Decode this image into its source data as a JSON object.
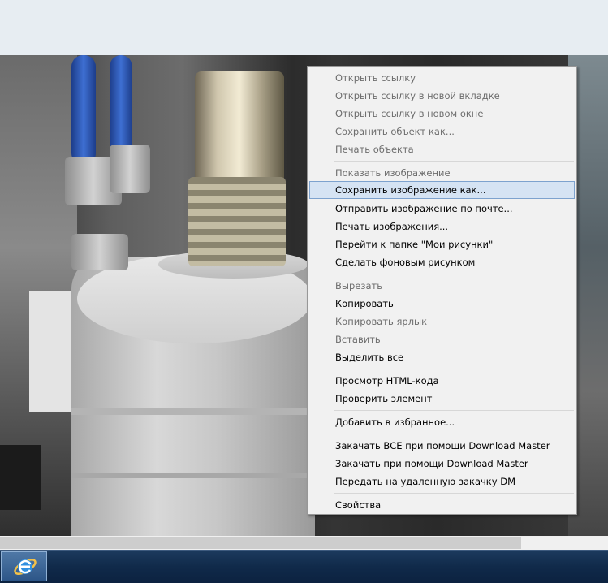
{
  "menu": {
    "items": [
      {
        "label": "Открыть ссылку",
        "enabled": false
      },
      {
        "label": "Открыть ссылку в новой вкладке",
        "enabled": false
      },
      {
        "label": "Открыть ссылку в новом окне",
        "enabled": false
      },
      {
        "label": "Сохранить объект как...",
        "enabled": false
      },
      {
        "label": "Печать объекта",
        "enabled": false
      },
      {
        "label": "Показать изображение",
        "enabled": false
      },
      {
        "label": "Сохранить изображение как...",
        "enabled": true,
        "highlighted": true
      },
      {
        "label": "Отправить изображение по почте...",
        "enabled": true
      },
      {
        "label": "Печать изображения...",
        "enabled": true
      },
      {
        "label": "Перейти к папке \"Мои рисунки\"",
        "enabled": true
      },
      {
        "label": "Сделать фоновым рисунком",
        "enabled": true
      },
      {
        "label": "Вырезать",
        "enabled": false
      },
      {
        "label": "Копировать",
        "enabled": true
      },
      {
        "label": "Копировать ярлык",
        "enabled": false
      },
      {
        "label": "Вставить",
        "enabled": false
      },
      {
        "label": "Выделить все",
        "enabled": true
      },
      {
        "label": "Просмотр HTML-кода",
        "enabled": true
      },
      {
        "label": "Проверить элемент",
        "enabled": true
      },
      {
        "label": "Добавить в избранное...",
        "enabled": true
      },
      {
        "label": "Закачать ВСЕ при помощи Download Master",
        "enabled": true
      },
      {
        "label": "Закачать при помощи Download Master",
        "enabled": true
      },
      {
        "label": "Передать на удаленную закачку DM",
        "enabled": true
      },
      {
        "label": "Свойства",
        "enabled": true
      }
    ]
  },
  "taskbar": {
    "pinned": [
      {
        "icon": "internet-explorer-icon"
      }
    ]
  },
  "colors": {
    "menu_bg": "#f1f1f1",
    "highlight_bg": "#d5e3f3",
    "highlight_border": "#7da2ce",
    "disabled_text": "#6d6d6d",
    "taskbar": "#102a4a"
  }
}
